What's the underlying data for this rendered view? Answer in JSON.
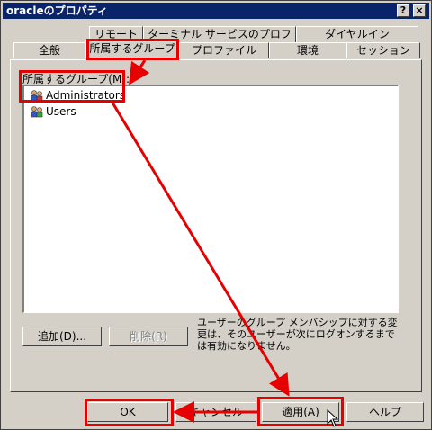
{
  "window": {
    "title": "oracleのプロパティ",
    "help_button": "?",
    "close_button": "×"
  },
  "tabs": {
    "row1": [
      "リモート制御",
      "ターミナル サービスのプロファイル",
      "ダイヤルイン"
    ],
    "row2": [
      "全般",
      "所属するグループ",
      "プロファイル",
      "環境",
      "セッション"
    ]
  },
  "groups": {
    "label": "所属するグループ(M):",
    "items": [
      "Administrators",
      "Users"
    ]
  },
  "panel_buttons": {
    "add": "追加(D)...",
    "remove": "削除(R)"
  },
  "description": "ユーザーのグループ メンバシップに対する変更は、そのユーザーが次にログオンするまでは有効になりません。",
  "dialog_buttons": {
    "ok": "OK",
    "cancel": "キャンセル",
    "apply": "適用(A)",
    "help": "ヘルプ"
  },
  "colors": {
    "titlebar": "#0a246a",
    "face": "#d4d0c8",
    "annotation": "#e60000"
  }
}
